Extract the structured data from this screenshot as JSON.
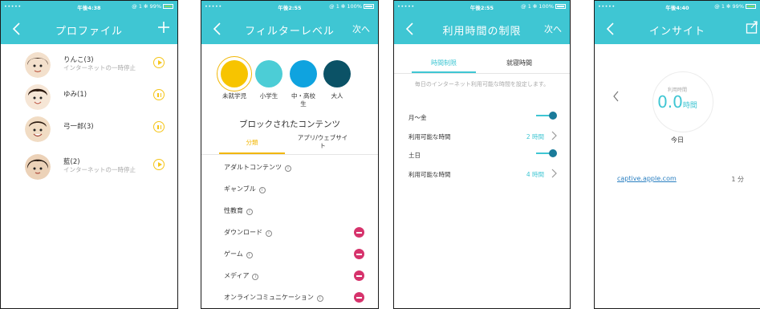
{
  "colors": {
    "accent": "#3fc6d3",
    "highlight": "#f2b705",
    "danger": "#d6336c"
  },
  "screen1": {
    "status": {
      "carrier": "•••••",
      "time": "午後4:38",
      "right": "@ 1 ✻ 99%"
    },
    "nav": {
      "title": "プロファイル",
      "back_icon": "chevron-left-icon",
      "add_icon": "plus-icon"
    },
    "profiles": [
      {
        "name": "りんこ(3)",
        "status": "インターネットの一時停止",
        "action": "play"
      },
      {
        "name": "ゆみ(1)",
        "status": "",
        "action": "pause"
      },
      {
        "name": "弓一郎(3)",
        "status": "",
        "action": "pause"
      },
      {
        "name": "藍(2)",
        "status": "インターネットの一時停止",
        "action": "play"
      }
    ]
  },
  "screen2": {
    "status": {
      "carrier": "•••••",
      "time": "午後2:55",
      "right": "@ 1 ✻ 100%"
    },
    "nav": {
      "title": "フィルターレベル",
      "next": "次へ"
    },
    "levels": [
      {
        "label": "未就学児",
        "color": "#f7c400",
        "selected": true
      },
      {
        "label": "小学生",
        "color": "#4ccdd6",
        "selected": false
      },
      {
        "label": "中・高校生",
        "color": "#0fa3df",
        "selected": false
      },
      {
        "label": "大人",
        "color": "#0b5266",
        "selected": false
      }
    ],
    "blocked_title": "ブロックされたコンテンツ",
    "tabs": {
      "category": "分類",
      "apps": "アプリ/ウェブサイト"
    },
    "categories": [
      {
        "label": "アダルトコンテンツ",
        "blocked": false
      },
      {
        "label": "ギャンブル",
        "blocked": false
      },
      {
        "label": "性教育",
        "blocked": false
      },
      {
        "label": "ダウンロード",
        "blocked": true
      },
      {
        "label": "ゲーム",
        "blocked": true
      },
      {
        "label": "メディア",
        "blocked": true
      },
      {
        "label": "オンラインコミュニケーション",
        "blocked": true
      }
    ]
  },
  "screen3": {
    "status": {
      "carrier": "•••••",
      "time": "午後2:55",
      "right": "@ 1 ✻ 100%"
    },
    "nav": {
      "title": "利用時間の制限",
      "next": "次へ"
    },
    "tabs": {
      "time_limit": "時間制限",
      "bedtime": "就寝時間"
    },
    "description": "毎日のインターネット利用可能な時間を設定します。",
    "weekday": {
      "label": "月～金",
      "enabled": true,
      "allowed_label": "利用可能な時間",
      "allowed_value": "2 時間"
    },
    "weekend": {
      "label": "土日",
      "enabled": true,
      "allowed_label": "利用可能な時間",
      "allowed_value": "4 時間"
    }
  },
  "screen4": {
    "status": {
      "carrier": "•••••",
      "time": "午後4:40",
      "right": "@ 1 ✻ 99%"
    },
    "nav": {
      "title": "インサイト"
    },
    "ring_label": "利用時間",
    "ring_value": "0.0",
    "ring_unit": "時間",
    "day": "今日",
    "sites": [
      {
        "domain": "captive.apple.com",
        "time": "1 分"
      }
    ]
  }
}
